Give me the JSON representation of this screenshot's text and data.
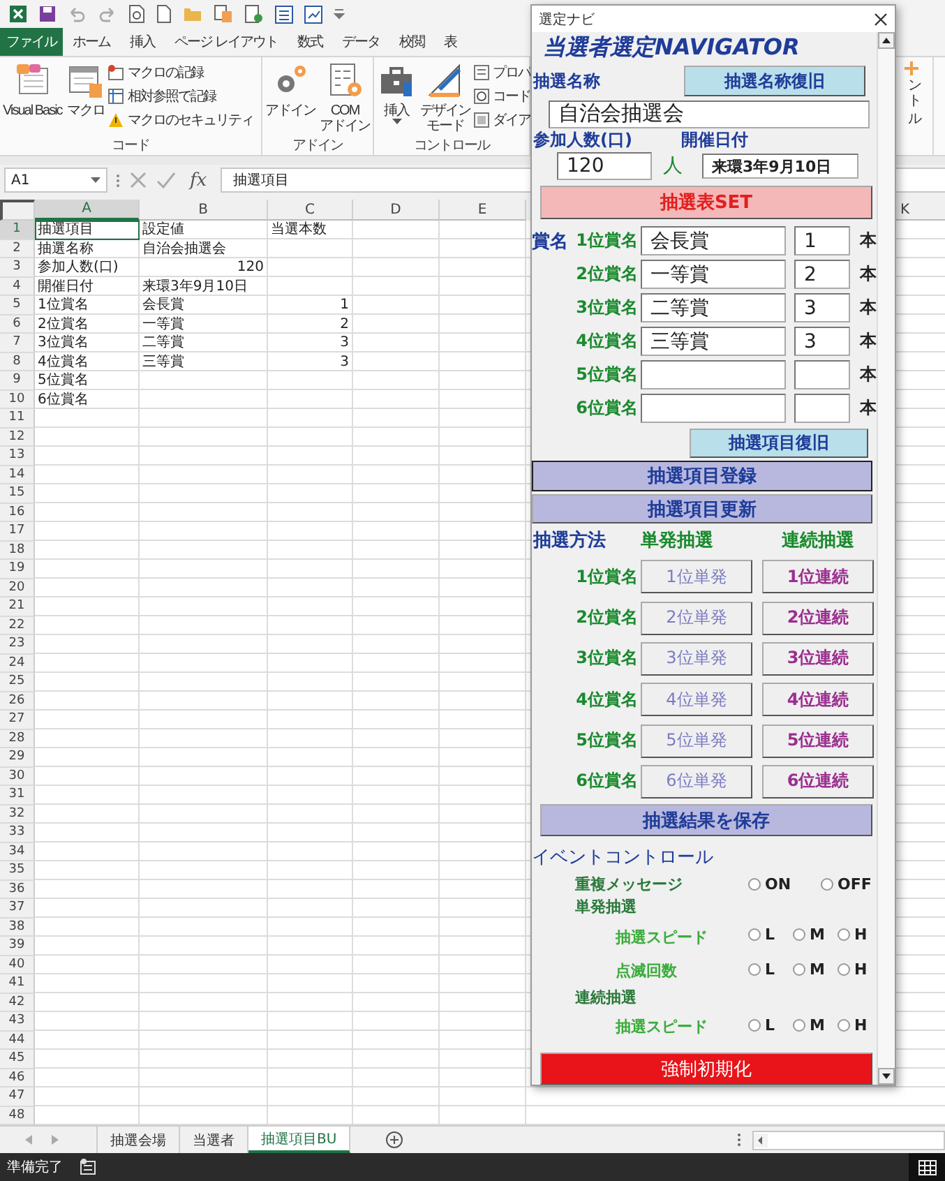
{
  "ribbon": {
    "file_tab": "ファイル",
    "tabs": [
      "ホーム",
      "挿入",
      "ページ レイアウト",
      "数式",
      "データ",
      "校閲",
      "表"
    ],
    "groups": [
      {
        "name": "コード",
        "large": [
          {
            "lines": [
              "Visual Basic"
            ]
          },
          {
            "lines": [
              "マクロ"
            ]
          }
        ],
        "small": [
          "マクロの記録",
          "相対参照で記録",
          "マクロのセキュリティ"
        ]
      },
      {
        "name": "アドイン",
        "large": [
          {
            "lines": [
              "アドイン"
            ]
          },
          {
            "lines": [
              "COM",
              "アドイン"
            ]
          }
        ]
      },
      {
        "name": "コントロール",
        "large": [
          {
            "lines": [
              "挿入"
            ],
            "dropdown": true
          },
          {
            "lines": [
              "デザイン",
              "モード"
            ]
          }
        ],
        "small": [
          "プロパ",
          "コード",
          "ダイア"
        ]
      }
    ],
    "right_fragment": {
      "lines": [
        "ント",
        "ル"
      ]
    }
  },
  "formula_bar": {
    "name_box": "A1",
    "function_label": "fx",
    "formula": "抽選項目"
  },
  "sheet": {
    "columns": [
      {
        "label": "A",
        "selected": true
      },
      {
        "label": "B",
        "selected": false
      },
      {
        "label": "C",
        "selected": false
      },
      {
        "label": "D",
        "selected": false
      },
      {
        "label": "E",
        "selected": false
      },
      {
        "label": "K",
        "selected": false
      }
    ],
    "rows": [
      {
        "number": "1",
        "selected": true,
        "cells": [
          {
            "text": "抽選項目",
            "kind": "text"
          },
          {
            "text": "設定値",
            "kind": "text"
          },
          {
            "text": "当選本数",
            "kind": "text"
          }
        ]
      },
      {
        "number": "2",
        "selected": false,
        "cells": [
          {
            "text": "抽選名称",
            "kind": "text"
          },
          {
            "text": "自治会抽選会",
            "kind": "text"
          }
        ]
      },
      {
        "number": "3",
        "selected": false,
        "cells": [
          {
            "text": "参加人数(口)",
            "kind": "text"
          },
          {
            "text": "120",
            "kind": "number"
          }
        ]
      },
      {
        "number": "4",
        "selected": false,
        "cells": [
          {
            "text": "開催日付",
            "kind": "text"
          },
          {
            "text": "来環3年9月10日",
            "kind": "text"
          }
        ]
      },
      {
        "number": "5",
        "selected": false,
        "cells": [
          {
            "text": "1位賞名",
            "kind": "text"
          },
          {
            "text": "会長賞",
            "kind": "text"
          },
          {
            "text": "1",
            "kind": "number"
          }
        ]
      },
      {
        "number": "6",
        "selected": false,
        "cells": [
          {
            "text": "2位賞名",
            "kind": "text"
          },
          {
            "text": "一等賞",
            "kind": "text"
          },
          {
            "text": "2",
            "kind": "number"
          }
        ]
      },
      {
        "number": "7",
        "selected": false,
        "cells": [
          {
            "text": "3位賞名",
            "kind": "text"
          },
          {
            "text": "二等賞",
            "kind": "text"
          },
          {
            "text": "3",
            "kind": "number"
          }
        ]
      },
      {
        "number": "8",
        "selected": false,
        "cells": [
          {
            "text": "4位賞名",
            "kind": "text"
          },
          {
            "text": "三等賞",
            "kind": "text"
          },
          {
            "text": "3",
            "kind": "number"
          }
        ]
      },
      {
        "number": "9",
        "selected": false,
        "cells": [
          {
            "text": "5位賞名",
            "kind": "text"
          }
        ]
      },
      {
        "number": "10",
        "selected": false,
        "cells": [
          {
            "text": "6位賞名",
            "kind": "text"
          }
        ]
      },
      {
        "number": "11",
        "selected": false
      },
      {
        "number": "12",
        "selected": false
      },
      {
        "number": "13",
        "selected": false
      },
      {
        "number": "14",
        "selected": false
      },
      {
        "number": "15",
        "selected": false
      },
      {
        "number": "16",
        "selected": false
      },
      {
        "number": "17",
        "selected": false
      },
      {
        "number": "18",
        "selected": false
      },
      {
        "number": "19",
        "selected": false
      },
      {
        "number": "20",
        "selected": false
      },
      {
        "number": "21",
        "selected": false
      },
      {
        "number": "22",
        "selected": false
      },
      {
        "number": "23",
        "selected": false
      },
      {
        "number": "24",
        "selected": false
      },
      {
        "number": "25",
        "selected": false
      },
      {
        "number": "26",
        "selected": false
      },
      {
        "number": "27",
        "selected": false
      },
      {
        "number": "28",
        "selected": false
      },
      {
        "number": "29",
        "selected": false
      },
      {
        "number": "30",
        "selected": false
      },
      {
        "number": "31",
        "selected": false
      },
      {
        "number": "32",
        "selected": false
      },
      {
        "number": "33",
        "selected": false
      },
      {
        "number": "34",
        "selected": false
      },
      {
        "number": "35",
        "selected": false
      },
      {
        "number": "36",
        "selected": false
      },
      {
        "number": "37",
        "selected": false
      },
      {
        "number": "38",
        "selected": false
      },
      {
        "number": "39",
        "selected": false
      },
      {
        "number": "40",
        "selected": false
      },
      {
        "number": "41",
        "selected": false
      },
      {
        "number": "42",
        "selected": false
      },
      {
        "number": "43",
        "selected": false
      },
      {
        "number": "44",
        "selected": false
      },
      {
        "number": "45",
        "selected": false
      },
      {
        "number": "46",
        "selected": false
      },
      {
        "number": "47",
        "selected": false
      },
      {
        "number": "48",
        "selected": false
      }
    ]
  },
  "sheet_tabs": [
    {
      "label": "抽選会場",
      "selected": false
    },
    {
      "label": "当選者",
      "selected": false
    },
    {
      "label": "抽選項目BU",
      "selected": true
    }
  ],
  "status_bar": {
    "text": "準備完了"
  },
  "dialog": {
    "title": "選定ナビ",
    "heading": "当選者選定NAVIGATOR",
    "name_label": "抽選名称",
    "restore_name_button": "抽選名称復旧",
    "name_value": "自治会抽選会",
    "count_label": "参加人数(口)",
    "date_label": "開催日付",
    "count_value": "120",
    "count_unit": "人",
    "date_value": "来環3年9月10日",
    "set_button": "抽選表SET",
    "prize_label": "賞名",
    "prizes": [
      {
        "label": "1位賞名",
        "name": "会長賞",
        "count": "1",
        "unit": "本"
      },
      {
        "label": "2位賞名",
        "name": "一等賞",
        "count": "2",
        "unit": "本"
      },
      {
        "label": "3位賞名",
        "name": "二等賞",
        "count": "3",
        "unit": "本"
      },
      {
        "label": "4位賞名",
        "name": "三等賞",
        "count": "3",
        "unit": "本"
      },
      {
        "label": "5位賞名",
        "unit": "本"
      },
      {
        "label": "6位賞名",
        "unit": "本"
      }
    ],
    "restore_items_button": "抽選項目復旧",
    "register_button": "抽選項目登録",
    "update_button": "抽選項目更新",
    "method_label": "抽選方法",
    "single_header": "単発抽選",
    "series_header": "連続抽選",
    "methods": [
      {
        "label": "1位賞名",
        "single": "1位単発",
        "series": "1位連続"
      },
      {
        "label": "2位賞名",
        "single": "2位単発",
        "series": "2位連続"
      },
      {
        "label": "3位賞名",
        "single": "3位単発",
        "series": "3位連続"
      },
      {
        "label": "4位賞名",
        "single": "4位単発",
        "series": "4位連続"
      },
      {
        "label": "5位賞名",
        "single": "5位単発",
        "series": "5位連続"
      },
      {
        "label": "6位賞名",
        "single": "6位単発",
        "series": "6位連続"
      }
    ],
    "save_button": "抽選結果を保存",
    "event_label": "イベントコントロール",
    "settings": [
      {
        "kind": "option",
        "label": "重複メッセージ",
        "options": [
          {
            "label": "ON",
            "selected": false
          },
          {
            "label": "OFF",
            "selected": false
          }
        ]
      },
      {
        "kind": "section",
        "label": "単発抽選"
      },
      {
        "kind": "sub_option",
        "label": "抽選スピード",
        "options": [
          {
            "label": "L",
            "selected": false
          },
          {
            "label": "M",
            "selected": false
          },
          {
            "label": "H",
            "selected": false
          }
        ]
      },
      {
        "kind": "sub_option",
        "label": "点滅回数",
        "options": [
          {
            "label": "L",
            "selected": false
          },
          {
            "label": "M",
            "selected": false
          },
          {
            "label": "H",
            "selected": false
          }
        ]
      },
      {
        "kind": "section",
        "label": "連続抽選"
      },
      {
        "kind": "sub_option",
        "label": "抽選スピード",
        "options": [
          {
            "label": "L",
            "selected": false
          },
          {
            "label": "M",
            "selected": false
          },
          {
            "label": "H",
            "selected": false
          }
        ]
      }
    ],
    "reset_button": "強制初期化"
  }
}
